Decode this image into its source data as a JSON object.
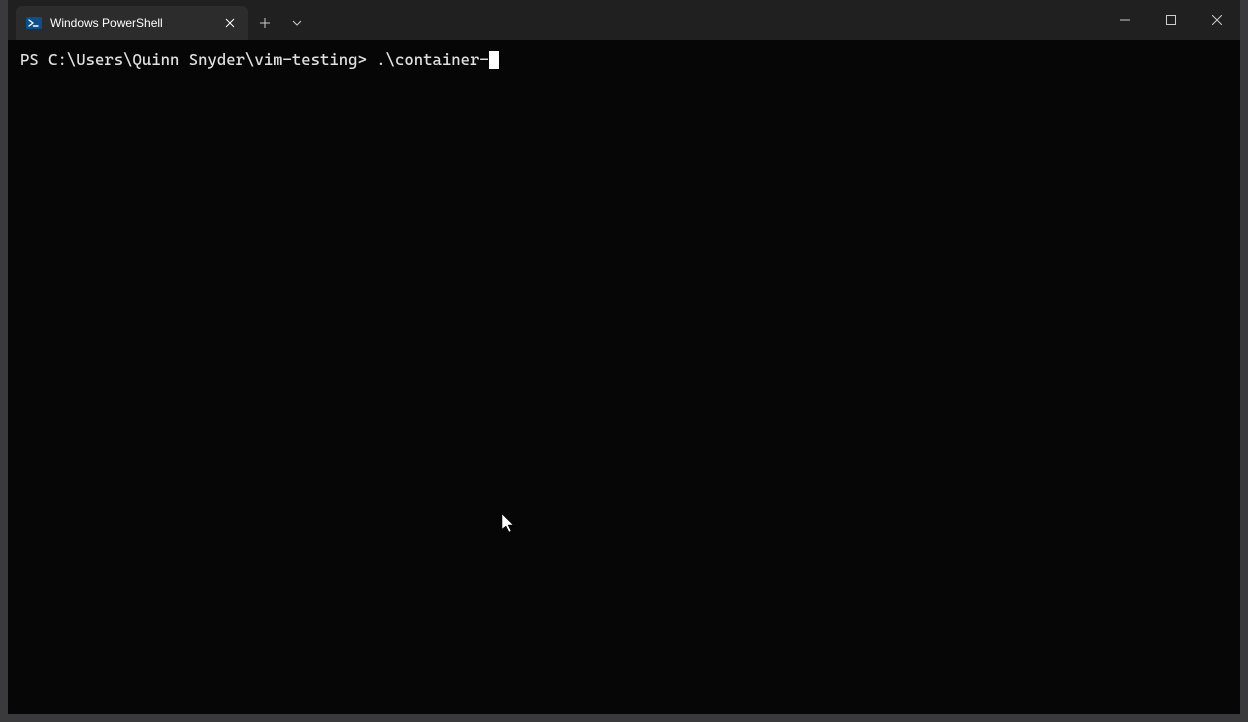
{
  "window": {
    "tab": {
      "title": "Windows PowerShell",
      "icon_name": "powershell-icon"
    }
  },
  "terminal": {
    "prompt": "PS C:\\Users\\Quinn Snyder\\vim-testing> ",
    "input": ".\\container-"
  }
}
